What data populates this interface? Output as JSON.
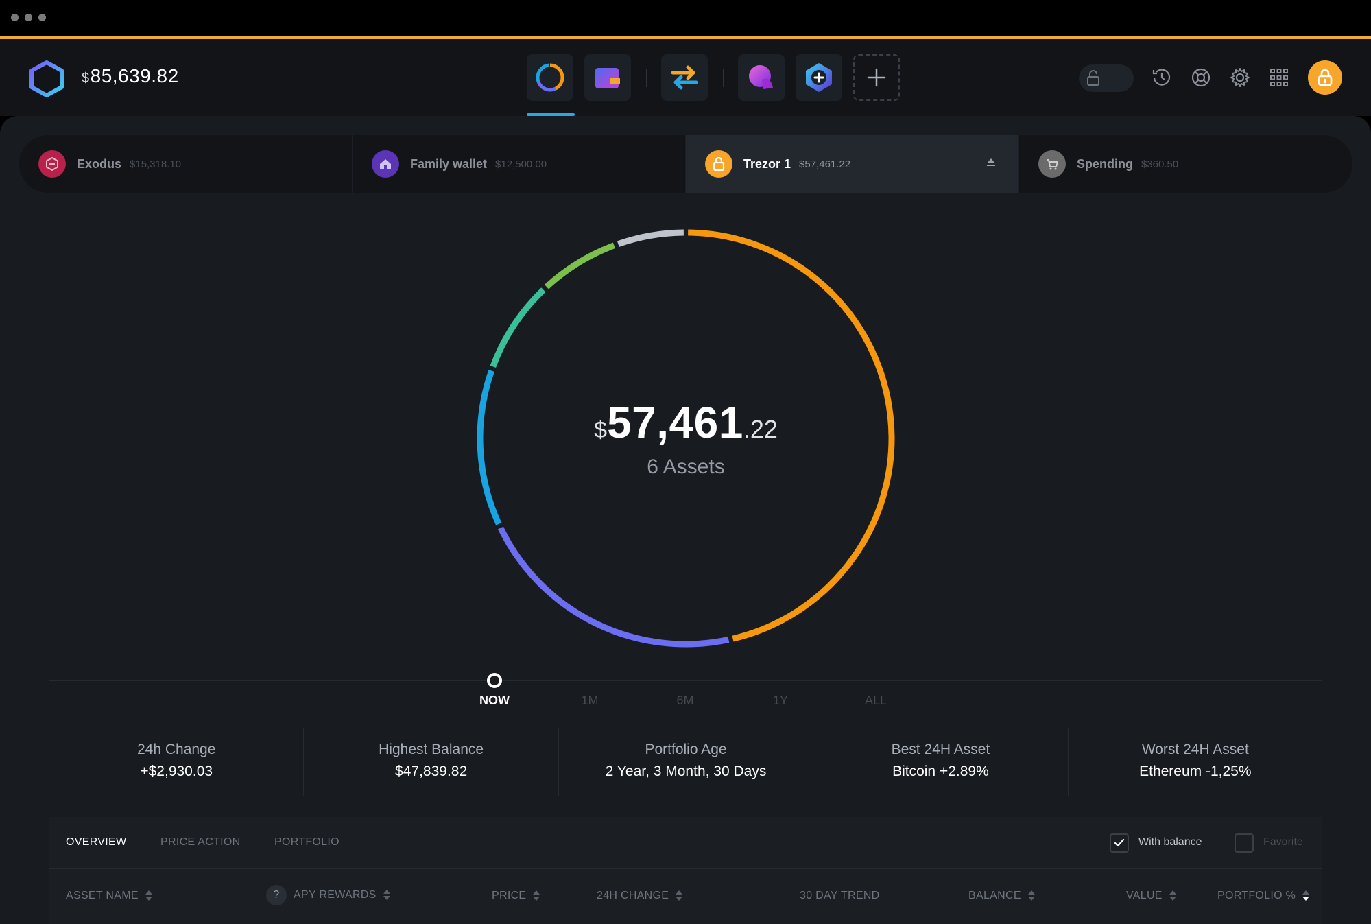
{
  "header": {
    "currency_symbol": "$",
    "total_balance": "85,639.82",
    "brand_color": "#f2a93b"
  },
  "nav": {
    "items": [
      {
        "name": "portfolio",
        "icon": "portfolio-ring-icon"
      },
      {
        "name": "wallet",
        "icon": "wallet-icon"
      },
      {
        "name": "exchange",
        "icon": "exchange-arrows-icon"
      },
      {
        "name": "app-1",
        "icon": "app-icon"
      },
      {
        "name": "app-2",
        "icon": "hexagon-plus-icon"
      },
      {
        "name": "add-app",
        "icon": "plus-icon"
      }
    ],
    "active": "portfolio"
  },
  "wallets": [
    {
      "name": "Exodus",
      "balance": "$15,318.10",
      "icon": "exodus-logo-icon",
      "color": "#b8224a"
    },
    {
      "name": "Family wallet",
      "balance": "$12,500.00",
      "icon": "home-icon",
      "color": "#5b35b5"
    },
    {
      "name": "Trezor 1",
      "balance": "$57,461.22",
      "icon": "lock-icon",
      "color": "#f7a52b",
      "active": true
    },
    {
      "name": "Spending",
      "balance": "$360.50",
      "icon": "cart-icon",
      "color": "#6b6b6b"
    }
  ],
  "portfolio": {
    "currency_symbol": "$",
    "amount_main": "57,461",
    "amount_decimals": ".22",
    "assets_label": "6 Assets",
    "segments": [
      {
        "color": "#f5970f",
        "percent": 46.5
      },
      {
        "color": "#6b6ef0",
        "percent": 21.5
      },
      {
        "color": "#19a3e0",
        "percent": 12.5
      },
      {
        "color": "#3bbf9a",
        "percent": 7.5
      },
      {
        "color": "#7cbf4d",
        "percent": 6.5
      },
      {
        "color": "#bfc4cc",
        "percent": 5.5
      }
    ]
  },
  "timeline": {
    "labels": [
      "NOW",
      "1M",
      "6M",
      "1Y",
      "ALL"
    ],
    "active": "NOW"
  },
  "stats": [
    {
      "label": "24h Change",
      "value": "+$2,930.03"
    },
    {
      "label": "Highest Balance",
      "value": "$47,839.82"
    },
    {
      "label": "Portfolio Age",
      "value": "2 Year, 3 Month, 30 Days"
    },
    {
      "label": "Best 24H Asset",
      "value": "Bitcoin +2.89%"
    },
    {
      "label": "Worst 24H Asset",
      "value": "Ethereum -1,25%"
    }
  ],
  "table": {
    "tabs": [
      "OVERVIEW",
      "PRICE ACTION",
      "PORTFOLIO"
    ],
    "active_tab": "OVERVIEW",
    "filters": [
      {
        "label": "With balance",
        "checked": true
      },
      {
        "label": "Favorite",
        "checked": false
      }
    ],
    "columns": [
      "ASSET NAME",
      "APY REWARDS",
      "PRICE",
      "24H CHANGE",
      "30 DAY TREND",
      "BALANCE",
      "VALUE",
      "PORTFOLIO %"
    ],
    "help_glyph": "?"
  }
}
